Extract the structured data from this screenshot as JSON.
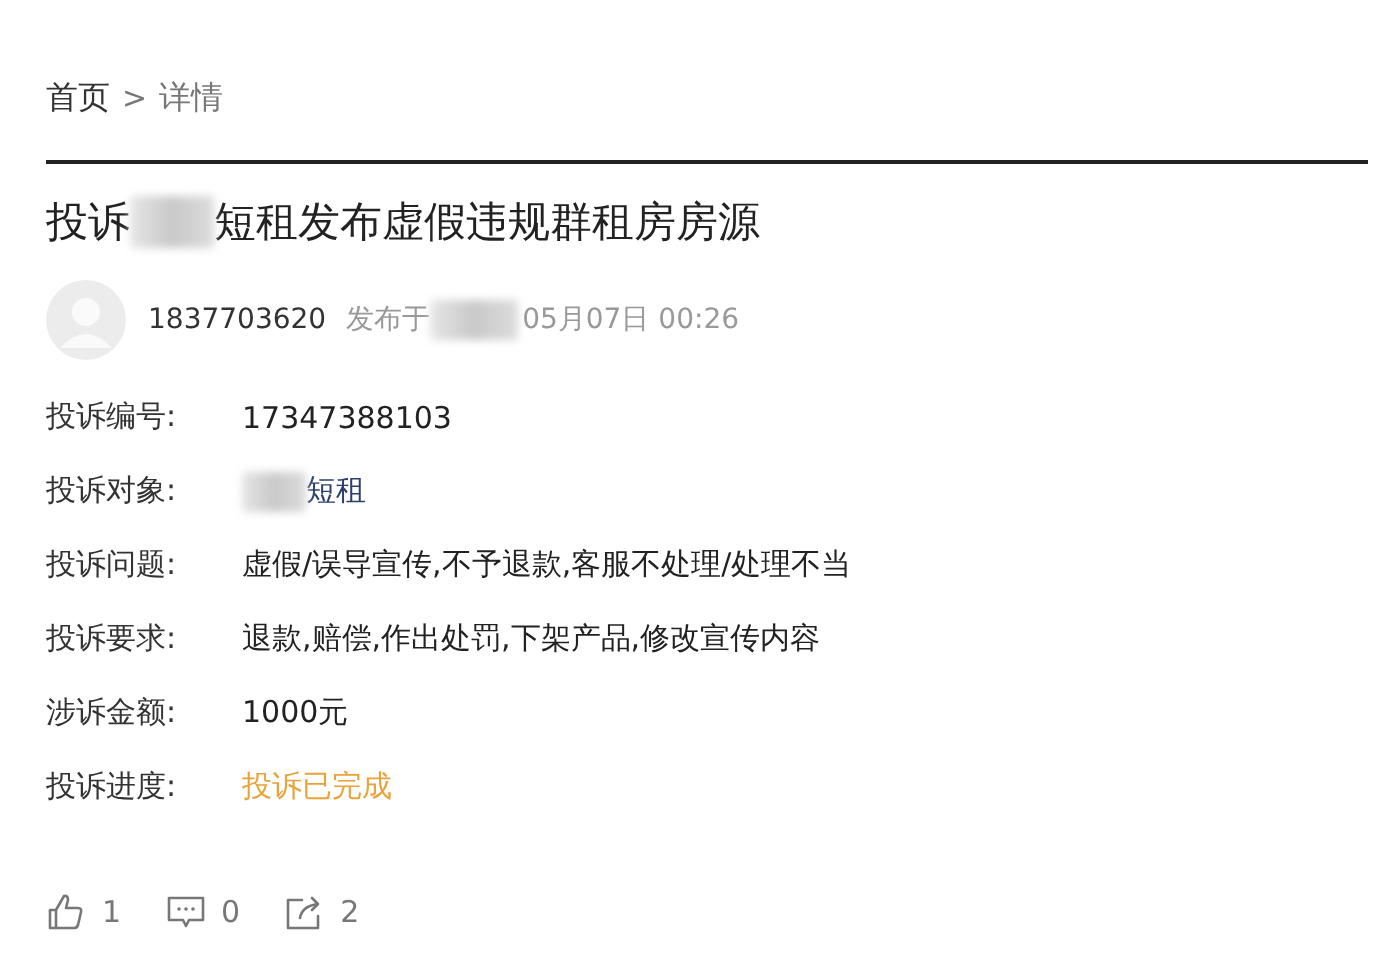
{
  "breadcrumb": {
    "items": [
      {
        "label": "首页"
      },
      {
        "label": "详情"
      }
    ],
    "separator": ">"
  },
  "title": {
    "parts": [
      {
        "kind": "text",
        "text": "投诉"
      },
      {
        "kind": "redacted"
      },
      {
        "kind": "text",
        "text": "短租发布虚假违规群租房房源"
      }
    ]
  },
  "author": {
    "name": "1837703620",
    "posted_label": "发布于",
    "date_parts": [
      {
        "kind": "redacted"
      },
      {
        "kind": "text",
        "text": "05月07日 00:26"
      }
    ]
  },
  "fields": [
    {
      "label": "投诉编号:",
      "kind": "text",
      "parts": [
        {
          "kind": "text",
          "text": "17347388103"
        }
      ]
    },
    {
      "label": "投诉对象:",
      "kind": "link",
      "parts": [
        {
          "kind": "redacted"
        },
        {
          "kind": "text",
          "text": "短租"
        }
      ]
    },
    {
      "label": "投诉问题:",
      "kind": "text",
      "parts": [
        {
          "kind": "text",
          "text": "虚假/误导宣传,不予退款,客服不处理/处理不当"
        }
      ]
    },
    {
      "label": "投诉要求:",
      "kind": "text",
      "parts": [
        {
          "kind": "text",
          "text": "退款,赔偿,作出处罚,下架产品,修改宣传内容"
        }
      ]
    },
    {
      "label": "涉诉金额:",
      "kind": "text",
      "parts": [
        {
          "kind": "text",
          "text": "1000元"
        }
      ]
    },
    {
      "label": "投诉进度:",
      "kind": "status",
      "parts": [
        {
          "kind": "text",
          "text": "投诉已完成"
        }
      ]
    }
  ],
  "actions": [
    {
      "kind": "like",
      "count": "1"
    },
    {
      "kind": "comment",
      "count": "0"
    },
    {
      "kind": "share",
      "count": "2"
    }
  ]
}
